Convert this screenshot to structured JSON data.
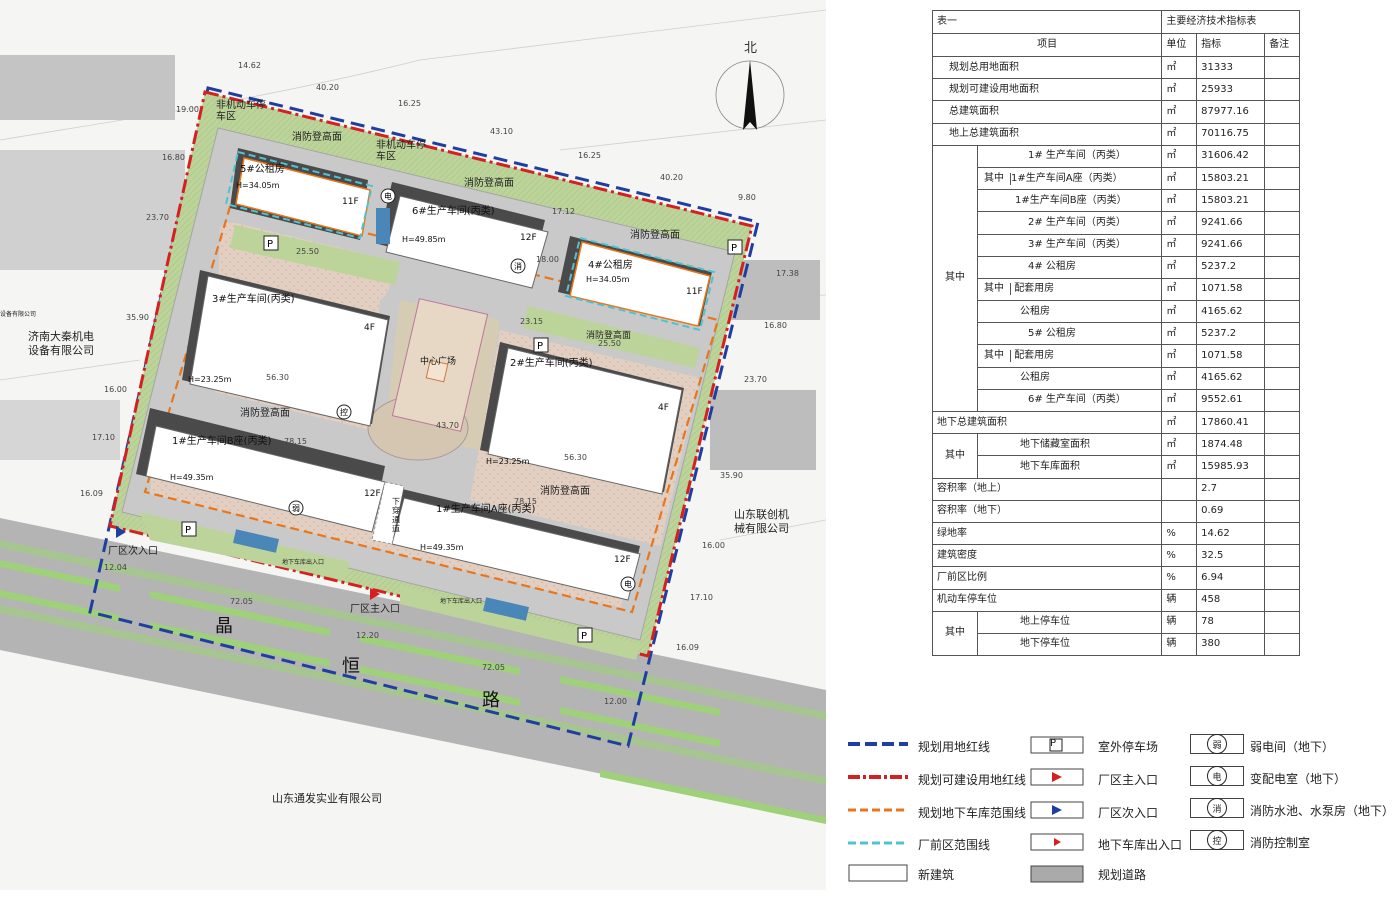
{
  "table": {
    "caption_left": "表一",
    "caption_title": "主要经济技术指标表",
    "headers": [
      "项目",
      "单位",
      "指标",
      "备注"
    ],
    "rows": [
      {
        "item": "规划总用地面积",
        "unit": "㎡",
        "value": "31333"
      },
      {
        "item": "规划可建设用地面积",
        "unit": "㎡",
        "value": "25933"
      },
      {
        "item": "总建筑面积",
        "unit": "㎡",
        "value": "87977.16"
      },
      {
        "item": "地上总建筑面积",
        "unit": "㎡",
        "value": "70116.75"
      },
      {
        "item": "1# 生产车间（丙类）",
        "unit": "㎡",
        "value": "31606.42"
      },
      {
        "item": "1#生产车间A座（丙类）",
        "unit": "㎡",
        "value": "15803.21"
      },
      {
        "item": "1#生产车间B座（丙类）",
        "unit": "㎡",
        "value": "15803.21"
      },
      {
        "item": "2# 生产车间（丙类）",
        "unit": "㎡",
        "value": "9241.66"
      },
      {
        "item": "3# 生产车间（丙类）",
        "unit": "㎡",
        "value": "9241.66"
      },
      {
        "item": "4# 公租房",
        "unit": "㎡",
        "value": "5237.2"
      },
      {
        "item": "配套用房",
        "unit": "㎡",
        "value": "1071.58"
      },
      {
        "item": "公租房",
        "unit": "㎡",
        "value": "4165.62"
      },
      {
        "item": "5# 公租房",
        "unit": "㎡",
        "value": "5237.2"
      },
      {
        "item": "配套用房",
        "unit": "㎡",
        "value": "1071.58"
      },
      {
        "item": "公租房",
        "unit": "㎡",
        "value": "4165.62"
      },
      {
        "item": "6# 生产车间（丙类）",
        "unit": "㎡",
        "value": "9552.61"
      },
      {
        "item": "地下总建筑面积",
        "unit": "㎡",
        "value": "17860.41"
      },
      {
        "item": "地下储藏室面积",
        "unit": "㎡",
        "value": "1874.48"
      },
      {
        "item": "地下车库面积",
        "unit": "㎡",
        "value": "15985.93"
      },
      {
        "item": "容积率（地上）",
        "unit": "",
        "value": "2.7"
      },
      {
        "item": "容积率（地下）",
        "unit": "",
        "value": "0.69"
      },
      {
        "item": "绿地率",
        "unit": "%",
        "value": "14.62"
      },
      {
        "item": "建筑密度",
        "unit": "%",
        "value": "32.5"
      },
      {
        "item": "厂前区比例",
        "unit": "%",
        "value": "6.94"
      },
      {
        "item": "机动车停车位",
        "unit": "辆",
        "value": "458"
      },
      {
        "item": "地上停车位",
        "unit": "辆",
        "value": "78"
      },
      {
        "item": "地下停车位",
        "unit": "辆",
        "value": "380"
      }
    ],
    "group_labels": {
      "qizhong": "其中"
    }
  },
  "legend": {
    "col1": [
      "规划用地红线",
      "规划可建设用地红线",
      "规划地下车库范围线",
      "厂前区范围线",
      "新建筑"
    ],
    "col2": [
      "室外停车场",
      "厂区主入口",
      "厂区次入口",
      "地下车库出入口",
      "规划道路"
    ],
    "col3": [
      "弱电间（地下）",
      "变配电室（地下）",
      "消防水池、水泵房（地下）",
      "消防控制室"
    ],
    "col3_symbols": [
      "弱",
      "电",
      "消",
      "控"
    ],
    "parking_symbol": "P"
  },
  "plan": {
    "north": "北",
    "neighbors": {
      "west": "济南大秦机电\n设备有限公司",
      "west_small": "设备有限公司",
      "east": "山东联创机\n械有限公司",
      "south": "山东通发实业有限公司"
    },
    "road_chars": [
      "晶",
      "恒",
      "路"
    ],
    "buildings": {
      "b5": "5#公租房",
      "b5_h": "H=34.05m",
      "b5_f": "11F",
      "b6": "6#生产车间(丙类)",
      "b6_h": "H=49.85m",
      "b6_f": "12F",
      "b4": "4#公租房",
      "b4_h": "H=34.05m",
      "b4_f": "11F",
      "b3": "3#生产车间(丙类)",
      "b3_h": "H=23.25m",
      "b3_f": "4F",
      "b2": "2#生产车间(丙类)",
      "b2_h": "H=23.25m",
      "b2_f": "4F",
      "b1b": "1#生产车间B座(丙类)",
      "b1b_h": "H=49.35m",
      "b1b_f": "12F",
      "b1a": "1#生产车间A座(丙类)",
      "b1a_h": "H=49.35m",
      "b1a_f": "12F",
      "plaza": "中心广场"
    },
    "labels": {
      "nonmotor1": "非机动车停\n车区",
      "nonmotor2": "非机动车停\n车区",
      "fire1": "消防登高面",
      "fire2": "消防登高面",
      "fire3": "消防登高面",
      "fire4": "消防登高面",
      "fire5": "消防登高面",
      "fire6": "消防登高面",
      "gate_main": "厂区主入口",
      "gate_sub": "厂区次入口",
      "underpass": "下\n穿\n通\n道",
      "garage_in1": "地下车库出入口",
      "garage_in2": "地下车库出入口"
    },
    "dims": {
      "d1": "14.62",
      "d2": "40.20",
      "d3": "16.25",
      "d4": "43.10",
      "d5": "16.25",
      "d6": "40.20",
      "d7": "9.80",
      "d8": "25.50",
      "d9": "18.00",
      "d10": "23.15",
      "d11": "25.50",
      "d12": "56.30",
      "d13": "43.70",
      "d14": "56.30",
      "d15": "78.15",
      "d16": "78.15",
      "d17": "12.04",
      "d18": "72.05",
      "d19": "12.20",
      "d20": "72.05",
      "d21": "12.00",
      "d22": "19.00",
      "d23": "16.80",
      "d24": "23.70",
      "d25": "35.90",
      "d26": "16.00",
      "d27": "17.10",
      "d28": "16.09",
      "d29": "17.38",
      "d30": "16.80",
      "d31": "23.70",
      "d32": "35.90",
      "d33": "16.00",
      "d34": "17.10",
      "d35": "16.09",
      "d36": "17.12"
    }
  },
  "colors": {
    "red_line": "#d42020",
    "blue_line": "#1f3fa0",
    "orange_line": "#e8761c",
    "cyan_line": "#4fc4d0",
    "green": "#b7cf8f",
    "road": "#a8a8a8",
    "paving": "#ddc7b8"
  }
}
